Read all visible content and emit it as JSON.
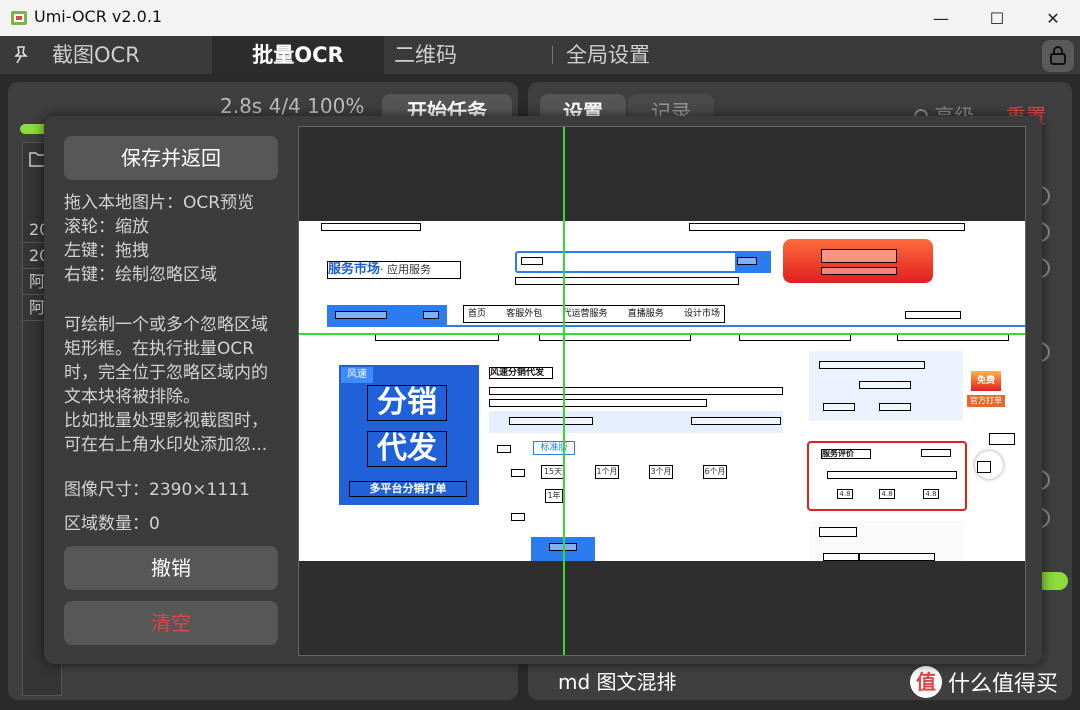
{
  "window": {
    "title": "Umi-OCR v2.0.1",
    "minimize_glyph": "—",
    "maximize_glyph": "☐",
    "close_glyph": "✕"
  },
  "tabs": [
    {
      "label": "截图OCR"
    },
    {
      "label": "批量OCR"
    },
    {
      "label": "二维码"
    },
    {
      "label": "全局设置"
    }
  ],
  "batch": {
    "elapsed": "2.8s",
    "count": "4/4",
    "percent": "100%",
    "start_label": "开始任务",
    "progress_fraction": 1.0,
    "file_cells": [
      "20",
      "20",
      "阿",
      "阿"
    ]
  },
  "settings_panel": {
    "tab_settings": "设置",
    "tab_records": "记录",
    "advanced_label": "高级",
    "reset_label": "重置",
    "layout_label": "md 图文混排"
  },
  "overlay": {
    "save_label": "保存并返回",
    "help_lines": [
      "拖入本地图片：OCR预览",
      "滚轮：缩放",
      "左键：拖拽",
      "右键：绘制忽略区域"
    ],
    "desc_lines": [
      "可绘制一个或多个忽略区域",
      "矩形框。在执行批量OCR",
      "时，完全位于忽略区域内的",
      "文本块将被排除。",
      "比如批量处理影视截图时，",
      "可在右上角水印处添加忽..."
    ],
    "image_size": "图像尺寸：2390×1111",
    "region_count": "区域数量：0",
    "undo_label": "撤销",
    "clear_label": "清空"
  },
  "preview": {
    "service_market": "服务市场",
    "service_sub": "· 应用服务",
    "nav_items": [
      "首页",
      "客服外包",
      "代运营服务",
      "直播服务",
      "设计市场"
    ],
    "banner_top": "风速",
    "banner_line1": "分销",
    "banner_line2": "代发",
    "banner_footer": "多平台分销打单",
    "product_title": "风速分销代发",
    "standard": "标准版",
    "periods": [
      "15天",
      "1个月",
      "3个月",
      "6个月",
      "1年"
    ],
    "free_badge": "免费",
    "official": "官方打单",
    "rating_title": "服务评价",
    "rating_scores": [
      "4.8",
      "4.8",
      "4.8"
    ]
  },
  "watermark": {
    "logo": "值",
    "text": "什么值得买"
  },
  "colors": {
    "accent_green": "#8bdc3c",
    "danger_red": "#e0454a",
    "guide_green": "#2fdc2f"
  }
}
